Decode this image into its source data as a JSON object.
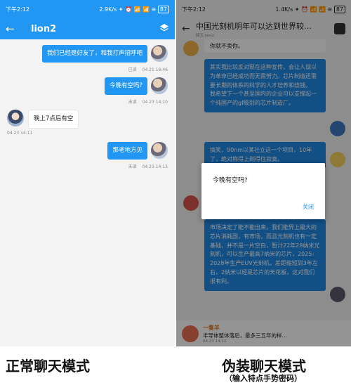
{
  "left": {
    "status": {
      "time": "下午2:12",
      "speed": "2.9K/s",
      "signal_icons": "✦ ⏰ 📶 📶 ≋",
      "battery": "87"
    },
    "appbar": {
      "title": "lion2"
    },
    "messages": [
      {
        "dir": "out",
        "text": "我们已经是好友了，和我打声招呼吧",
        "status": "已读",
        "time": "04.21 16:46"
      },
      {
        "dir": "out",
        "text": "今晚有空吗?",
        "status": "未读",
        "time": "04.23 14:10"
      },
      {
        "dir": "in",
        "text": "晚上7点后有空",
        "time": "04.23 14:11"
      },
      {
        "dir": "out",
        "text": "那老地方见",
        "status": "未读",
        "time": "04.23 14:13"
      }
    ]
  },
  "right": {
    "status": {
      "time": "下午2:12",
      "speed": "1.4K/s",
      "signal_icons": "✦ ⏰ 📶 📶 ≋",
      "battery": "87"
    },
    "header": {
      "title": "中国光刻机明年可以达到世界较…",
      "subtitle": "韩玉 lion2"
    },
    "top_reply": "你就不卖你。",
    "article1": "其实我比较反对现在这种宣传，会让人误以为革命已经成功而无需努力。芯片制造还需要长期的体系的科学的人才培养和烧钱。\n我希望下一个甚至国内的企业可以支撑起一个纯国产的gf级别的芯片制造厂。",
    "article2": "搞笑，90nm以某社立这一个项目，10年了，绝对称得上剃得住寂寞。",
    "article3": "市场决定了能不能出来，我们能界上最大的芯片消耗国，有市场，而且光刻机也有一定基础，并不是一片空白，暂计22年28纳米光刻机，可以生产最高7纳米的芯片，2025-2028年生产EUV光刻机，差距缩短到3年左右，2纳米以经是芯片的天花板，这对我们很有利。",
    "dialog": {
      "message": "今晚有空吗?",
      "close": "关闭"
    },
    "bottom": {
      "name": "一隻羊",
      "text": "半导体整体落后，最多三五年的样…",
      "time": "04.23 14:13"
    }
  },
  "captions": {
    "left": "正常聊天模式",
    "right": "伪装聊天模式",
    "right_sub": "（输入特点手势密码）"
  }
}
